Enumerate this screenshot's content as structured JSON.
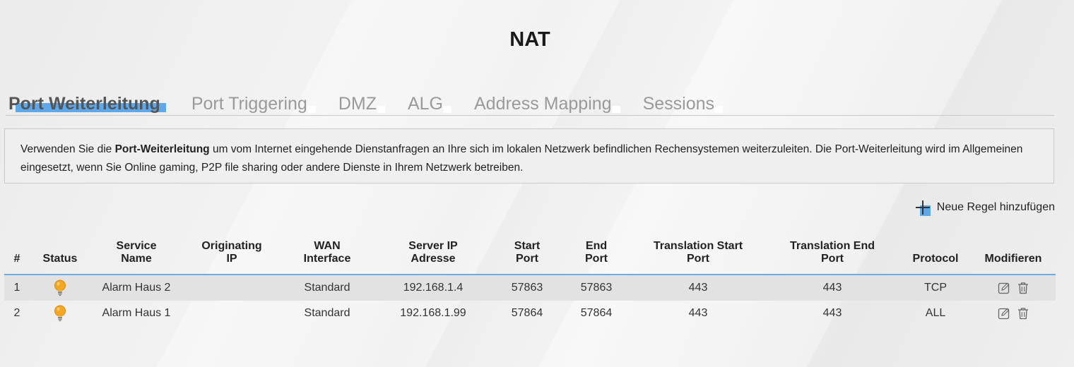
{
  "page": {
    "title": "NAT"
  },
  "tabs": [
    {
      "label": "Port Weiterleitung",
      "active": true
    },
    {
      "label": "Port Triggering",
      "active": false
    },
    {
      "label": "DMZ",
      "active": false
    },
    {
      "label": "ALG",
      "active": false
    },
    {
      "label": "Address Mapping",
      "active": false
    },
    {
      "label": "Sessions",
      "active": false
    }
  ],
  "info": {
    "pre": "Verwenden Sie die ",
    "bold": "Port-Weiterleitung",
    "post": " um vom Internet eingehende Dienstanfragen an Ihre sich im lokalen Netzwerk befindlichen Rechensystemen weiterzuleiten. Die Port-Weiterleitung wird im Allgemeinen eingesetzt, wenn Sie Online gaming, P2P file sharing oder andere Dienste in Ihrem Netzwerk betreiben."
  },
  "add_rule": {
    "label": "Neue Regel hinzufügen",
    "icon": "plus-icon"
  },
  "table": {
    "headers": {
      "num": "#",
      "status": "Status",
      "service_name": [
        "Service",
        "Name"
      ],
      "originating_ip": [
        "Originating",
        "IP"
      ],
      "wan_interface": [
        "WAN",
        "Interface"
      ],
      "server_ip": [
        "Server IP",
        "Adresse"
      ],
      "start_port": [
        "Start",
        "Port"
      ],
      "end_port": [
        "End",
        "Port"
      ],
      "trans_start_port": [
        "Translation Start",
        "Port"
      ],
      "trans_end_port": [
        "Translation End",
        "Port"
      ],
      "protocol": "Protocol",
      "modify": "Modifieren"
    },
    "rows": [
      {
        "num": "1",
        "status_icon": "lightbulb-icon",
        "service_name": "Alarm Haus 2",
        "originating_ip": "",
        "wan_interface": "Standard",
        "server_ip": "192.168.1.4",
        "start_port": "57863",
        "end_port": "57863",
        "trans_start_port": "443",
        "trans_end_port": "443",
        "protocol": "TCP"
      },
      {
        "num": "2",
        "status_icon": "lightbulb-icon",
        "service_name": "Alarm Haus 1",
        "originating_ip": "",
        "wan_interface": "Standard",
        "server_ip": "192.168.1.99",
        "start_port": "57864",
        "end_port": "57864",
        "trans_start_port": "443",
        "trans_end_port": "443",
        "protocol": "ALL"
      }
    ]
  },
  "colors": {
    "accent": "#5ea8ea",
    "bulb": "#f5a623"
  }
}
